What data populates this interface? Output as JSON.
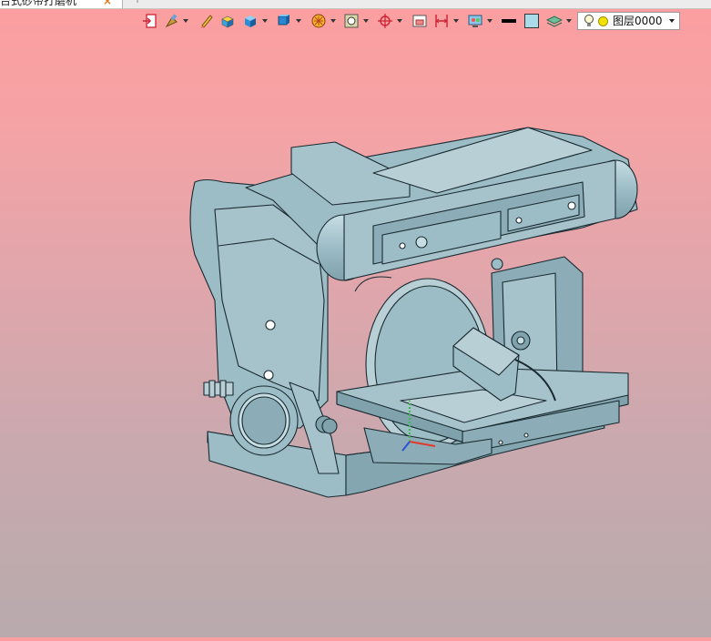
{
  "document_tab": {
    "title": "台式砂带打磨机",
    "close_glyph": "×",
    "new_tab_glyph": "+"
  },
  "toolbar": {
    "layer": {
      "name": "图层0000"
    },
    "line_color": "#000000",
    "fill_color": "#a9dbe8"
  },
  "colors": {
    "background_top": "#fc9ea0",
    "background_bottom": "#b8aaad",
    "model_body": "#9cbcc6",
    "model_edges": "#1a2a30"
  }
}
